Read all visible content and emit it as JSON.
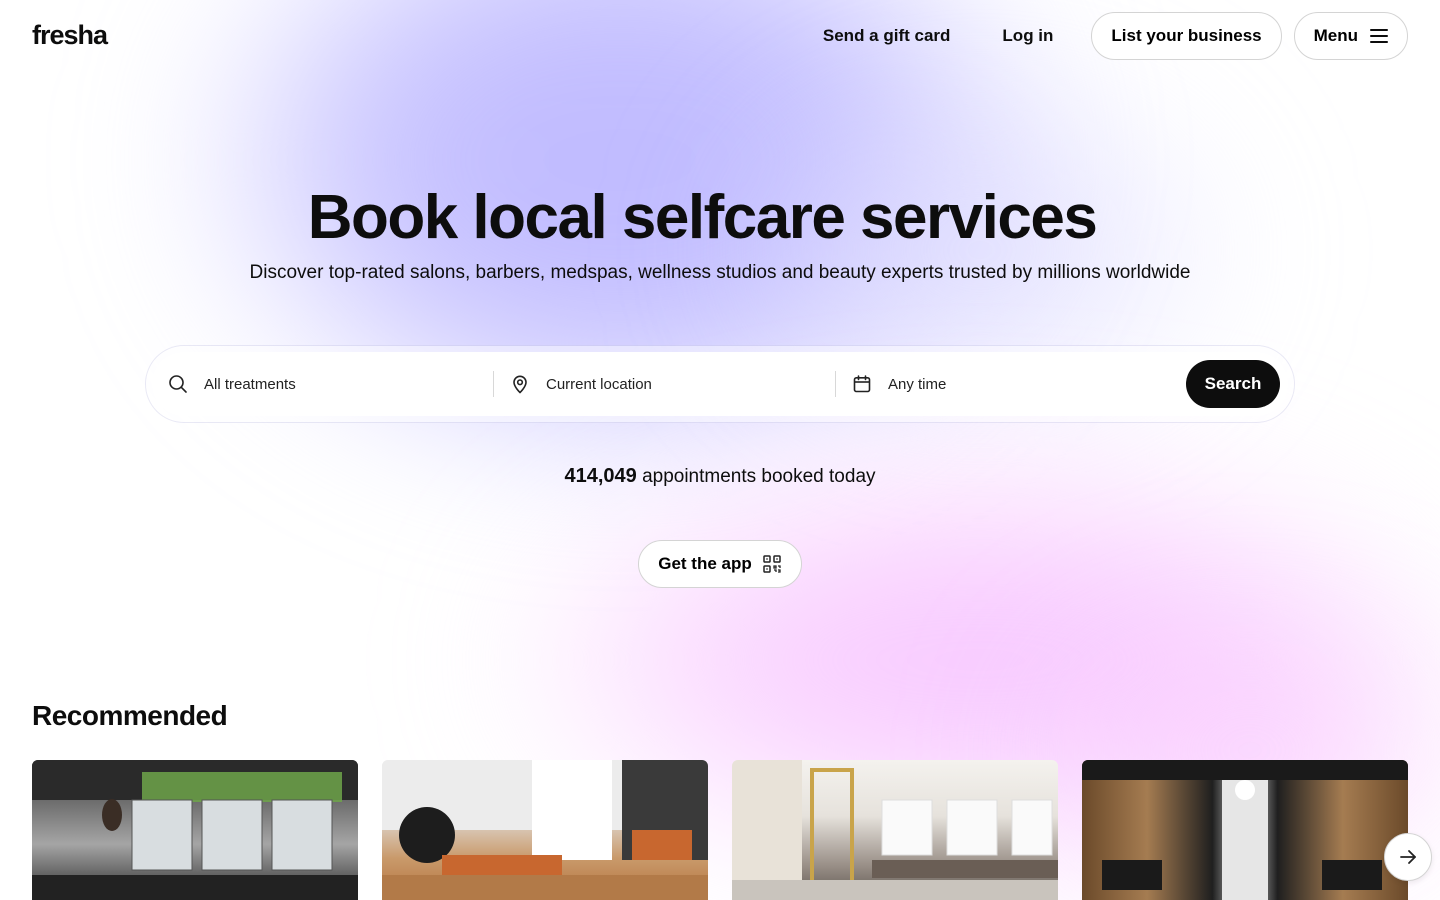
{
  "header": {
    "logo": "fresha",
    "gift_card": "Send a gift card",
    "login": "Log in",
    "list_business": "List your business",
    "menu": "Menu"
  },
  "hero": {
    "title": "Book local selfcare services",
    "subtitle": "Discover top-rated salons, barbers, medspas, wellness studios and beauty experts trusted by millions worldwide"
  },
  "search": {
    "treatments": "All treatments",
    "location": "Current location",
    "time": "Any time",
    "button": "Search",
    "icons": [
      "search-icon",
      "location-pin-icon",
      "calendar-icon"
    ]
  },
  "stats": {
    "count": "414,049",
    "label": "appointments booked today"
  },
  "app": {
    "label": "Get the app",
    "icon": "qr-code-icon"
  },
  "recommended": {
    "title": "Recommended",
    "cards": [
      "card-1",
      "card-2",
      "card-3",
      "card-4"
    ],
    "next_icon": "arrow-right-icon"
  },
  "colors": {
    "primary": "#0d0d0d",
    "gradient_purple": "#c8c4ff",
    "gradient_pink": "#fad5ff"
  }
}
